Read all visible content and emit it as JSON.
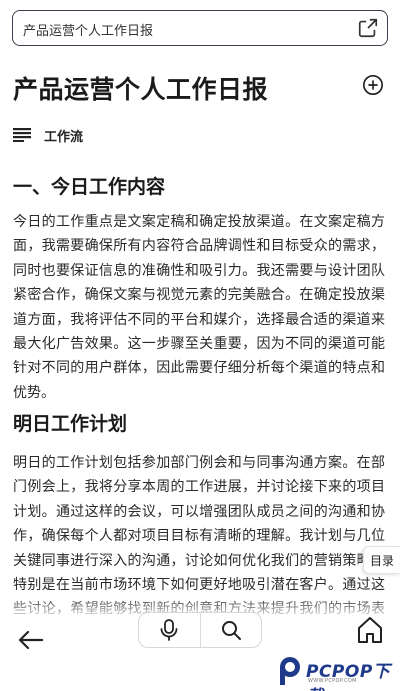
{
  "topbar": {
    "title": "产品运营个人工作日报",
    "icon": "open-external-icon"
  },
  "doc": {
    "title": "产品运营个人工作日报",
    "add_icon": "add-circle-icon",
    "workflow_label": "工作流",
    "sections": [
      {
        "heading": "一、今日工作内容",
        "body": "今日的工作重点是文案定稿和确定投放渠道。在文案定稿方面，我需要确保所有内容符合品牌调性和目标受众的需求，同时也要保证信息的准确性和吸引力。我还需要与设计团队紧密合作，确保文案与视觉元素的完美融合。在确定投放渠道方面，我将评估不同的平台和媒介，选择最合适的渠道来最大化广告效果。这一步骤至关重要，因为不同的渠道可能针对不同的用户群体，因此需要仔细分析每个渠道的特点和优势。"
      },
      {
        "heading": "明日工作计划",
        "body": "明日的工作计划包括参加部门例会和与同事沟通方案。在部门例会上，我将分享本周的工作进展，并讨论接下来的项目计划。通过这样的会议，可以增强团队成员之间的沟通和协作，确保每个人都对项目目标有清晰的理解。我计划与几位关键同事进行深入的沟通，讨论如何优化我们的营销策略，特别是在当前市场环境下如何更好地吸引潜在客户。通过这些讨论，希望能够找到新的创意和方法来提升我们的市场表现。"
      }
    ]
  },
  "toc": {
    "label": "目录"
  },
  "bottombar": {
    "back_icon": "arrow-left-icon",
    "mic_icon": "microphone-icon",
    "search_icon": "search-icon",
    "home_icon": "home-icon"
  },
  "watermark": {
    "text": "PCPOP下载",
    "sub": "WWW.PCPOP.COM"
  },
  "colors": {
    "border": "#3a4150",
    "watermark": "#1f3a8a",
    "text": "#2a2a2a"
  }
}
